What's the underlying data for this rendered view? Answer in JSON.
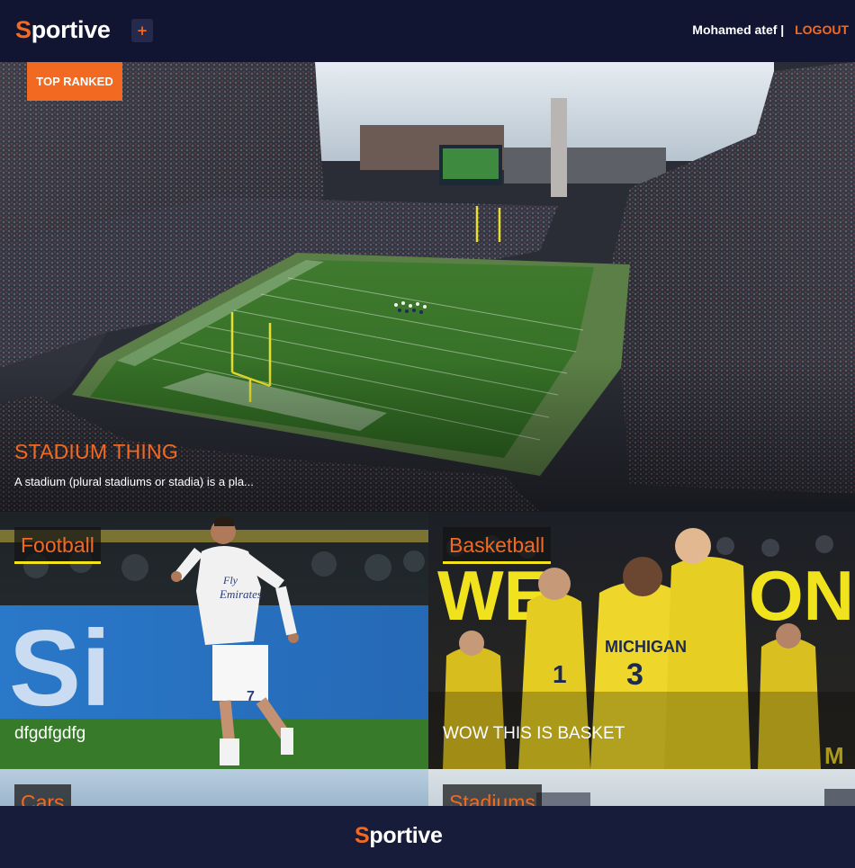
{
  "brand": {
    "first_letter": "S",
    "rest": "portive"
  },
  "header": {
    "add_label": "+",
    "username": "Mohamed atef",
    "separator": "|",
    "logout_label": "LOGOUT"
  },
  "hero": {
    "badge": "TOP RANKED",
    "title": "STADIUM THING",
    "description": "A stadium (plural stadiums or stadia) is a pla..."
  },
  "cards": [
    {
      "label": "Football",
      "caption": "dfgdfgdfg"
    },
    {
      "label": "Basketball",
      "caption": "WOW THIS IS BASKET"
    },
    {
      "label": "Cars",
      "caption": ""
    },
    {
      "label": "Stadiums",
      "caption": ""
    }
  ],
  "colors": {
    "accent": "#f26a21",
    "navbar": "#111531",
    "footer": "#171c3a",
    "underline": "#f2e31a"
  },
  "footer": {
    "first_letter": "S",
    "rest": "portive"
  }
}
